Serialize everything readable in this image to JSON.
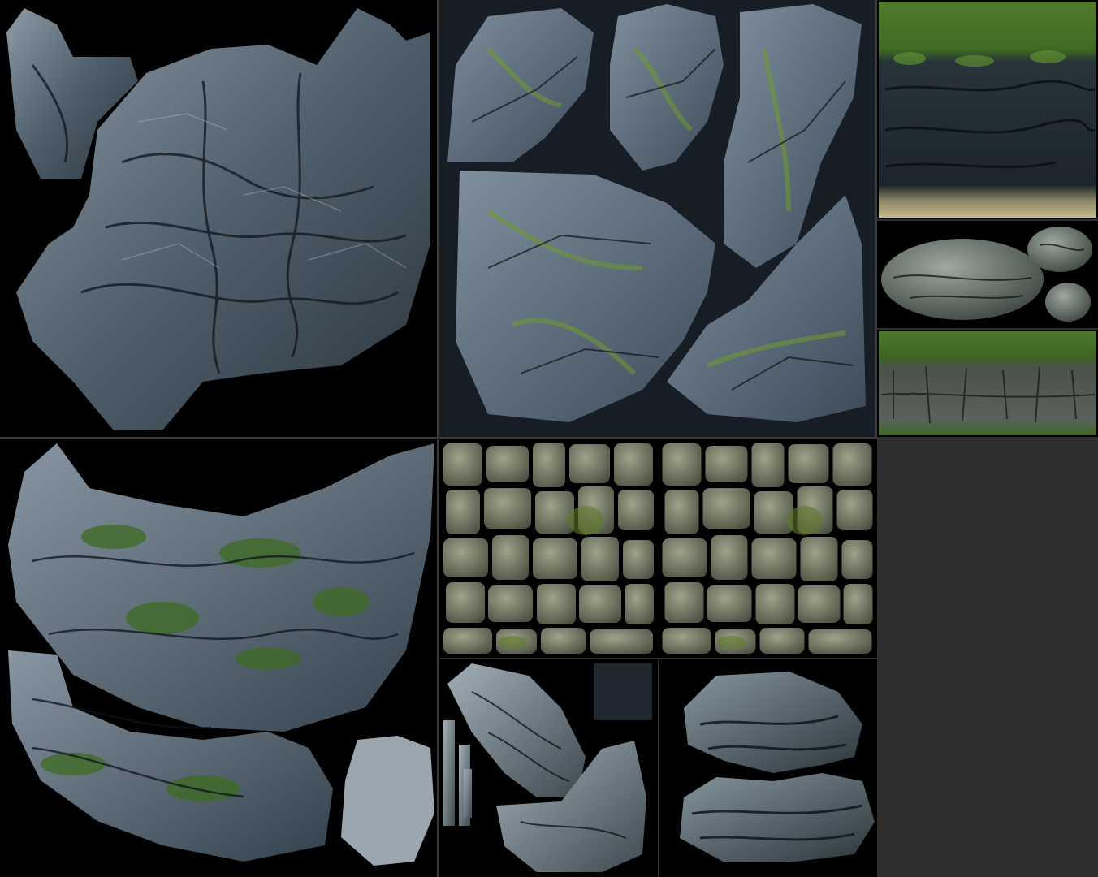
{
  "atlas": {
    "background_color": "#2e2e2e",
    "colors": {
      "void": "#000000",
      "slate_dark": "#1b242b",
      "slate_mid": "#4a5a66",
      "slate_light": "#9aa9b4",
      "crack": "#0c1014",
      "moss_dark": "#2f4a1a",
      "moss_light": "#6f9a2e",
      "grass": "#4f7a2a",
      "sand": "#b8a97a",
      "cobble_base": "#5b5f4f",
      "cobble_light": "#8e9379",
      "panel_dark_blue": "#171d24"
    },
    "panels": [
      {
        "id": "rock-cluster-large",
        "content": "rock-texture"
      },
      {
        "id": "rock-shards-mossy",
        "content": "rock-texture"
      },
      {
        "id": "cliff-grass-strip",
        "content": "grass-cliff-texture"
      },
      {
        "id": "boulders-small",
        "content": "rock-texture"
      },
      {
        "id": "cliff-grass-strip-2",
        "content": "grass-cliff-texture"
      },
      {
        "id": "mossy-rock-sheet",
        "content": "rock-texture"
      },
      {
        "id": "cobble-tile-a",
        "content": "cobblestone-texture"
      },
      {
        "id": "cobble-tile-b",
        "content": "cobblestone-texture"
      },
      {
        "id": "rock-strips",
        "content": "rock-texture"
      },
      {
        "id": "rock-pieces-dark",
        "content": "rock-texture"
      }
    ]
  }
}
